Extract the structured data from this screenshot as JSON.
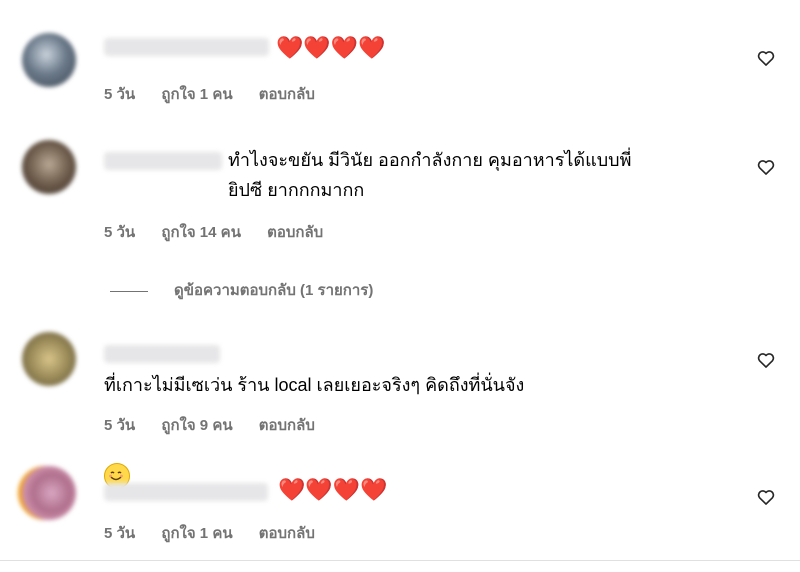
{
  "comments": [
    {
      "text": "❤️❤️❤️❤️",
      "time": "5 วัน",
      "likes": "ถูกใจ 1 คน",
      "reply": "ตอบกลับ"
    },
    {
      "text": "ทำไงจะขยัน มีวินัย ออกกำลังกาย คุมอาหารได้แบบพี่\nยิปซี ยากกกมากก",
      "time": "5 วัน",
      "likes": "ถูกใจ 14 คน",
      "reply": "ตอบกลับ"
    },
    {
      "text": "ที่เกาะไม่มีเซเว่น ร้าน local เลยเยอะจริงๆ คิดถึงที่นั่นจัง",
      "time": "5 วัน",
      "likes": "ถูกใจ 9 คน",
      "reply": "ตอบกลับ"
    },
    {
      "text": "❤️❤️❤️❤️",
      "time": "5 วัน",
      "likes": "ถูกใจ 1 คน",
      "reply": "ตอบกลับ"
    }
  ],
  "view_replies": "ดูข้อความตอบกลับ (1 รายการ)",
  "icons": {
    "like": "heart-outline-icon",
    "emoji": "smiling-face-icon"
  }
}
